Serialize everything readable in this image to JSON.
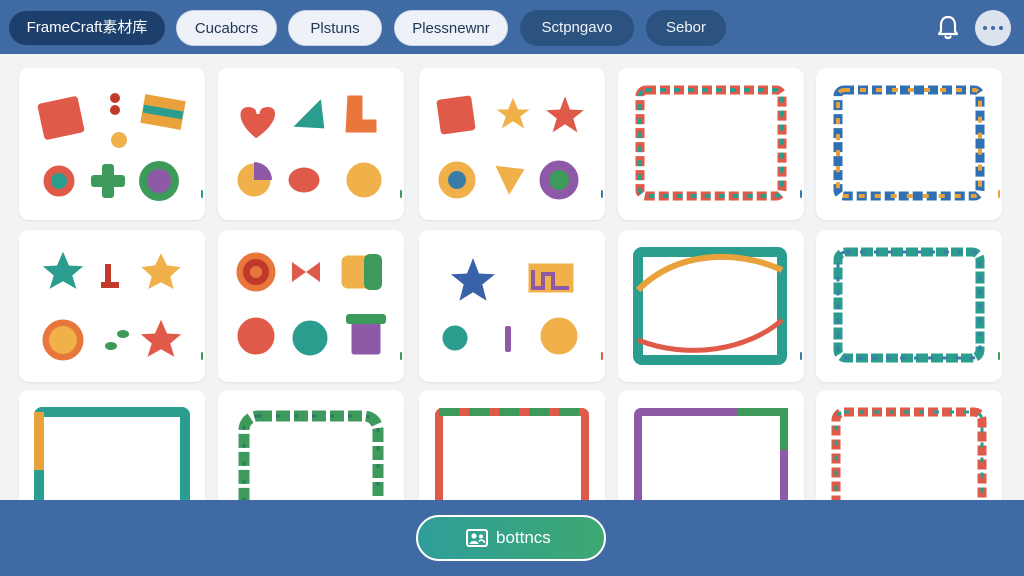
{
  "app": {
    "brand": "FrameCraft素材库"
  },
  "nav": {
    "tabs": [
      {
        "label": "Cucabcrs"
      },
      {
        "label": "Plstuns"
      },
      {
        "label": "Plessnewnr"
      },
      {
        "label": "Sctpngavo"
      },
      {
        "label": "Sebor"
      }
    ]
  },
  "header_icons": [
    "bell-icon",
    "more-icon"
  ],
  "grid": {
    "rows": 3,
    "columns": 5,
    "cards": [
      {
        "kind": "sticker-set",
        "motifs": [
          "shirt",
          "swirl",
          "flag",
          "ring",
          "cross",
          "flower-face"
        ]
      },
      {
        "kind": "sticker-set",
        "motifs": [
          "heart",
          "arrow",
          "boot",
          "pie",
          "bug",
          "ball"
        ]
      },
      {
        "kind": "sticker-set",
        "motifs": [
          "square",
          "star",
          "star",
          "swirl-circle",
          "triangle",
          "spiral"
        ]
      },
      {
        "kind": "frame",
        "style": "wavy",
        "colors": [
          "#e05a4a",
          "#2a9d8f"
        ]
      },
      {
        "kind": "frame",
        "style": "wavy",
        "colors": [
          "#2f6fb3",
          "#e9a23b"
        ]
      },
      {
        "kind": "sticker-set",
        "motifs": [
          "star",
          "tetromino",
          "star",
          "sun-face",
          "leaves",
          "star"
        ]
      },
      {
        "kind": "sticker-set",
        "motifs": [
          "spiral",
          "bowtie",
          "block",
          "ball",
          "round-flower",
          "cup"
        ]
      },
      {
        "kind": "sticker-set",
        "motifs": [
          "star",
          "maze",
          "blob",
          "stick",
          "ball"
        ]
      },
      {
        "kind": "frame",
        "style": "ribbon",
        "colors": [
          "#2a9d8f",
          "#e9a23b"
        ]
      },
      {
        "kind": "frame",
        "style": "wavy",
        "colors": [
          "#2a9d8f",
          "#3a7ca5"
        ]
      },
      {
        "kind": "frame",
        "style": "painted",
        "colors": [
          "#2a9d8f",
          "#e9a23b"
        ]
      },
      {
        "kind": "frame",
        "style": "beaded",
        "colors": [
          "#3d9a5b",
          "#2a7d60"
        ]
      },
      {
        "kind": "frame",
        "style": "drip",
        "colors": [
          "#e05a4a",
          "#3d9a5b"
        ]
      },
      {
        "kind": "frame",
        "style": "painted",
        "colors": [
          "#8e5aa8",
          "#3d9a5b"
        ]
      },
      {
        "kind": "frame",
        "style": "wavy",
        "colors": [
          "#e05a4a",
          "#2a9d8f"
        ]
      }
    ]
  },
  "bottom": {
    "cta_label": "bottncs",
    "cta_icon": "people-icon"
  },
  "colors": {
    "bar": "#3f6aa3",
    "brand_pill": "#1d3f6c",
    "grid_bg": "#f2f3f5",
    "cta": "#2f9e9a"
  }
}
